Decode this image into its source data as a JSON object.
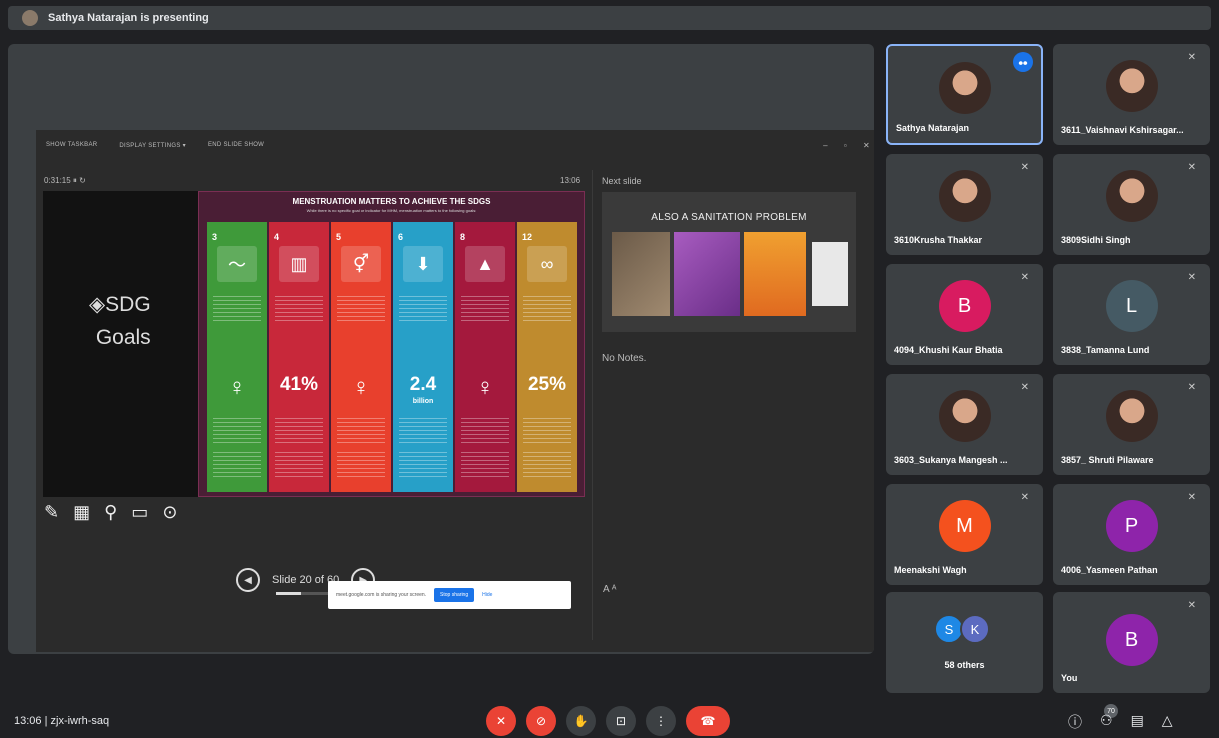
{
  "presenting_banner": "Sathya Natarajan is presenting",
  "presenter": {
    "toolbar": {
      "show_taskbar": "SHOW TASKBAR",
      "display_settings": "DISPLAY SETTINGS ▾",
      "end_slide_show": "END SLIDE SHOW"
    },
    "timer": "0:31:15  ⏸  ↻",
    "clock": "13:06",
    "next_slide_label": "Next slide",
    "notes": "No Notes.",
    "slide_nav": "Slide 20 of 60",
    "progress_fraction": 0.33,
    "current_slide": {
      "left_text_line1": "◈SDG",
      "left_text_line2": "Goals",
      "info_title": "MENSTRUATION MATTERS TO ACHIEVE THE SDGS",
      "info_subtitle": "While there is no specific goal or indicator for MHM, menstruation matters to the following goals:",
      "columns": [
        {
          "num": "3",
          "icon": "heartbeat-icon",
          "stat": "",
          "color": "#3f9a3a"
        },
        {
          "num": "4",
          "icon": "book-icon",
          "stat": "41%",
          "color": "#c8283a"
        },
        {
          "num": "5",
          "icon": "gender-icon",
          "stat": "",
          "color": "#e8402d"
        },
        {
          "num": "6",
          "icon": "water-icon",
          "stat": "2.4",
          "stat2": "billion",
          "color": "#27a0c8"
        },
        {
          "num": "8",
          "icon": "growth-icon",
          "stat": "",
          "color": "#a4193d"
        },
        {
          "num": "12",
          "icon": "infinity-icon",
          "stat": "25%",
          "color": "#bf8b2e"
        }
      ]
    },
    "next_slide_title": "ALSO A SANITATION PROBLEM",
    "font_controls": "A  ᴬ"
  },
  "share_bar": {
    "text": "meet.google.com is sharing your screen.",
    "stop": "Stop sharing",
    "hide": "Hide"
  },
  "participants": [
    {
      "name": "Sathya Natarajan",
      "initial": "",
      "color": "",
      "photo": true,
      "active": true
    },
    {
      "name": "3611_Vaishnavi Kshirsagar...",
      "initial": "",
      "color": "",
      "photo": true
    },
    {
      "name": "3610Krusha Thakkar",
      "initial": "",
      "color": "",
      "photo": true
    },
    {
      "name": "3809Sidhi Singh",
      "initial": "",
      "color": "",
      "photo": true
    },
    {
      "name": "4094_Khushi Kaur Bhatia",
      "initial": "B",
      "color": "#d81b60"
    },
    {
      "name": "3838_Tamanna Lund",
      "initial": "L",
      "color": "#455a64"
    },
    {
      "name": "3603_Sukanya Mangesh ...",
      "initial": "",
      "color": "",
      "photo": true
    },
    {
      "name": "3857_ Shruti Pilaware",
      "initial": "",
      "color": "",
      "photo": true
    },
    {
      "name": "Meenakshi Wagh",
      "initial": "M",
      "color": "#f4511e"
    },
    {
      "name": "4006_Yasmeen Pathan",
      "initial": "P",
      "color": "#8e24aa"
    }
  ],
  "others": {
    "label": "58 others",
    "a1": "S",
    "a1_color": "#1e88e5",
    "a2": "K",
    "a2_color": "#5c6bc0"
  },
  "you": {
    "label": "You",
    "initial": "B",
    "color": "#8e24aa"
  },
  "meeting": {
    "info": "13:06  |  zjx-iwrh-saq",
    "participant_count": "70"
  }
}
